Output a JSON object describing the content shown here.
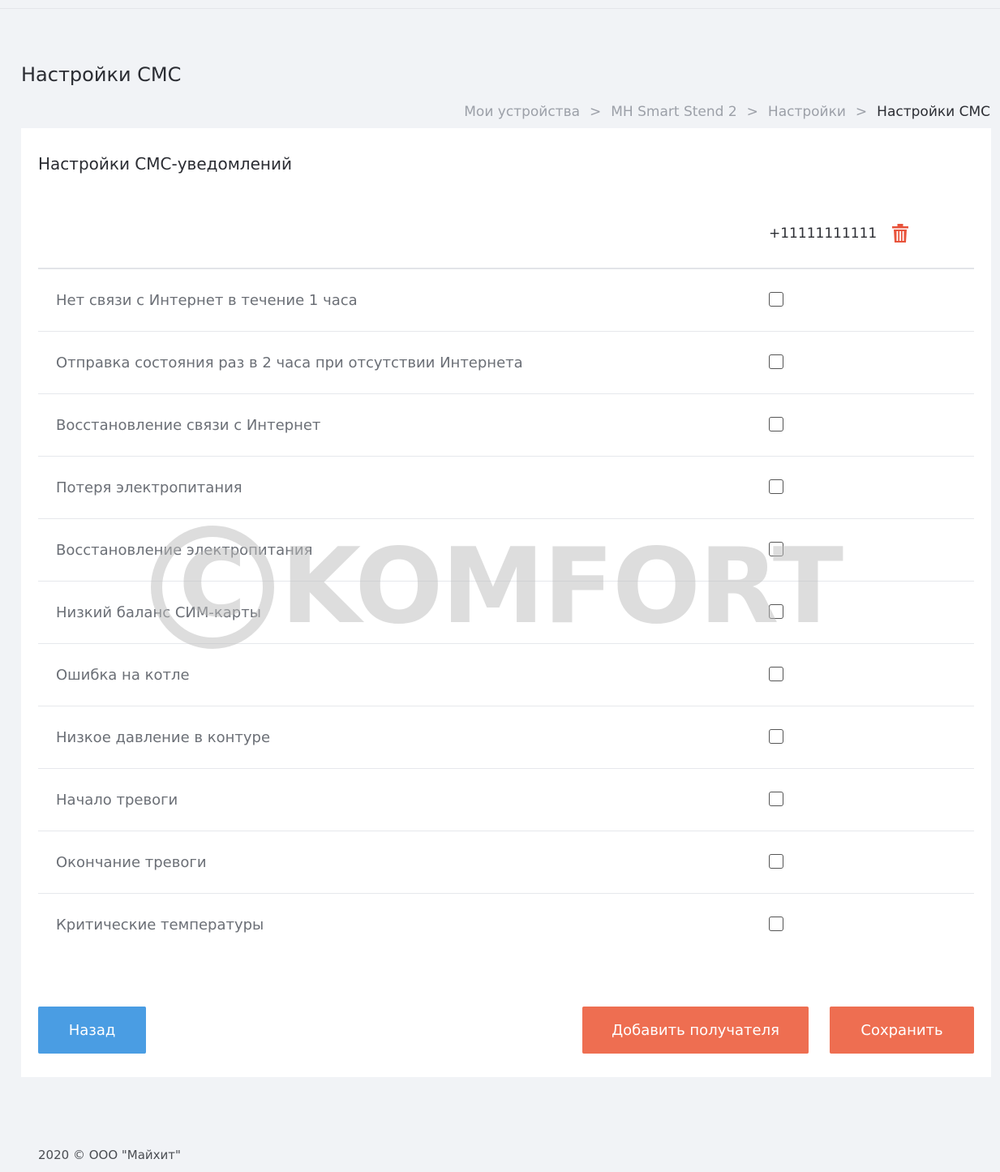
{
  "page": {
    "title": "Настройки СМС"
  },
  "breadcrumb": [
    "Мои устройства",
    "MH Smart Stend 2",
    "Настройки",
    "Настройки СМС"
  ],
  "breadcrumb_separator": ">",
  "card": {
    "title": "Настройки СМС-уведомлений",
    "recipient_phone": "+11111111111"
  },
  "notifications": [
    {
      "label": "Нет связи с Интернет в течение 1 часа",
      "checked": false
    },
    {
      "label": "Отправка состояния раз в 2 часа при отсутствии Интернета",
      "checked": false
    },
    {
      "label": "Восстановление связи с Интернет",
      "checked": false
    },
    {
      "label": "Потеря электропитания",
      "checked": false
    },
    {
      "label": "Восстановление электропитания",
      "checked": false
    },
    {
      "label": "Низкий баланс СИМ-карты",
      "checked": false
    },
    {
      "label": "Ошибка на котле",
      "checked": false
    },
    {
      "label": "Низкое давление в контуре",
      "checked": false
    },
    {
      "label": "Начало тревоги",
      "checked": false
    },
    {
      "label": "Окончание тревоги",
      "checked": false
    },
    {
      "label": "Критические температуры",
      "checked": false
    }
  ],
  "buttons": {
    "back": "Назад",
    "add_recipient": "Добавить получателя",
    "save": "Сохранить"
  },
  "footer": {
    "text": "2020 © ООО \"Майхит\""
  },
  "watermark": {
    "symbol": "C",
    "text": "KOMFORT"
  },
  "colors": {
    "background": "#f1f3f6",
    "primary_blue": "#4a9de3",
    "accent_orange": "#ee6e51",
    "trash_red": "#e8533b"
  },
  "icons": {
    "delete_recipient": "trash-icon"
  }
}
